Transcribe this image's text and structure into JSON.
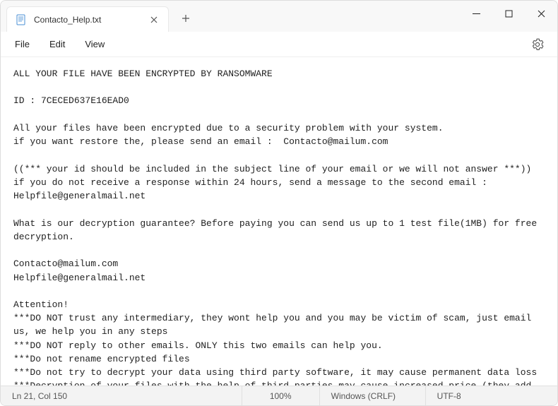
{
  "titlebar": {
    "tab_title": "Contacto_Help.txt"
  },
  "menu": {
    "file": "File",
    "edit": "Edit",
    "view": "View"
  },
  "content": "ALL YOUR FILE HAVE BEEN ENCRYPTED BY RANSOMWARE\n\nID : 7CECED637E16EAD0\n\nAll your files have been encrypted due to a security problem with your system.\nif you want restore the, please send an email :  Contacto@mailum.com\n\n((*** your id should be included in the subject line of your email or we will not answer ***))\nif you do not receive a response within 24 hours, send a message to the second email : Helpfile@generalmail.net\n\nWhat is our decryption guarantee? Before paying you can send us up to 1 test file(1MB) for free decryption.\n\nContacto@mailum.com\nHelpfile@generalmail.net\n\nAttention!\n***DO NOT trust any intermediary, they wont help you and you may be victim of scam, just email us, we help you in any steps\n***DO NOT reply to other emails. ONLY this two emails can help you.\n***Do not rename encrypted files\n***Do not try to decrypt your data using third party software, it may cause permanent data loss\n***Decryption of your files with the help of third parties may cause increased price (they add their fee to our) or you can become a victim of a scam",
  "status": {
    "position": "Ln 21, Col 150",
    "zoom": "100%",
    "eol": "Windows (CRLF)",
    "encoding": "UTF-8"
  }
}
